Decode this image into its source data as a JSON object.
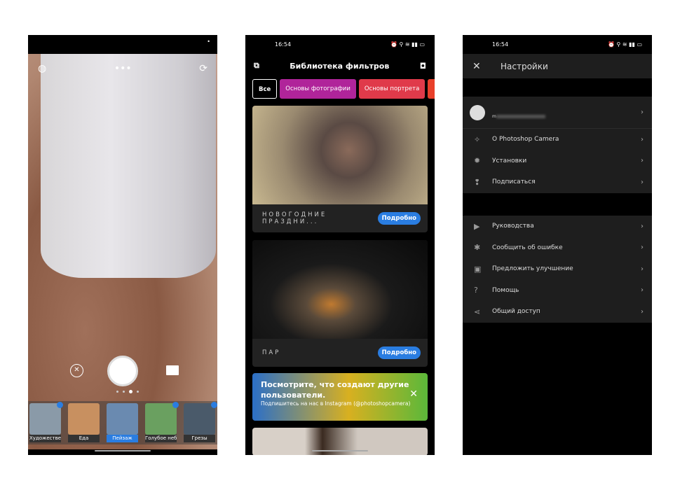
{
  "camera": {
    "status_dot": "•",
    "icons": [
      "globe-icon",
      "more-icon",
      "flip-camera-icon"
    ],
    "more": "•••",
    "filters": [
      {
        "label": "Художестве...",
        "premium": true,
        "color": "#8a9aa8"
      },
      {
        "label": "Еда",
        "premium": false,
        "color": "#c89060"
      },
      {
        "label": "Пейзаж",
        "premium": false,
        "selected": true,
        "color": "#6a8ab0"
      },
      {
        "label": "Голубое небо",
        "premium": true,
        "color": "#6aa060"
      },
      {
        "label": "Грезы",
        "premium": true,
        "color": "#4a5a6a"
      }
    ]
  },
  "library": {
    "status": {
      "time": "16:54",
      "icons": "⏰ ⚲ ≋ ▮▮ ▭"
    },
    "title": "Библиотека фильтров",
    "chips": [
      {
        "label": "Все",
        "style": "outline"
      },
      {
        "label": "Основы фотографии",
        "color": "#b0249a"
      },
      {
        "label": "Основы портрета",
        "color": "#e03a4a"
      }
    ],
    "cards": [
      {
        "caption": "НОВОГОДНИЕ ПРАЗДНИ...",
        "button": "Подробно"
      },
      {
        "caption": "ПАР",
        "button": "Подробно"
      }
    ],
    "banner": {
      "title": "Посмотрите, что создают другие пользователи.",
      "subtitle": "Подпишитесь на нас в Instagram (@photoshopcamera)",
      "close": "✕"
    }
  },
  "settings": {
    "status": {
      "time": "16:54",
      "icons": "⏰ ⚲ ≋ ▮▮ ▭"
    },
    "close": "✕",
    "title": "Настройки",
    "account_prefix": "m",
    "group1": [
      {
        "icon": "sparkle-icon",
        "glyph": "✧",
        "label": "О Photoshop Camera"
      },
      {
        "icon": "gear-icon",
        "glyph": "✹",
        "label": "Установки"
      },
      {
        "icon": "footprints-icon",
        "glyph": "❢",
        "label": "Подписаться"
      }
    ],
    "group2": [
      {
        "icon": "play-icon",
        "glyph": "▶",
        "label": "Руководства"
      },
      {
        "icon": "bug-icon",
        "glyph": "✱",
        "label": "Сообщить об ошибке"
      },
      {
        "icon": "comment-icon",
        "glyph": "▣",
        "label": "Предложить улучшение"
      },
      {
        "icon": "help-icon",
        "glyph": "?",
        "label": "Помощь"
      },
      {
        "icon": "share-icon",
        "glyph": "⋖",
        "label": "Общий доступ"
      }
    ],
    "chevron": "›"
  }
}
